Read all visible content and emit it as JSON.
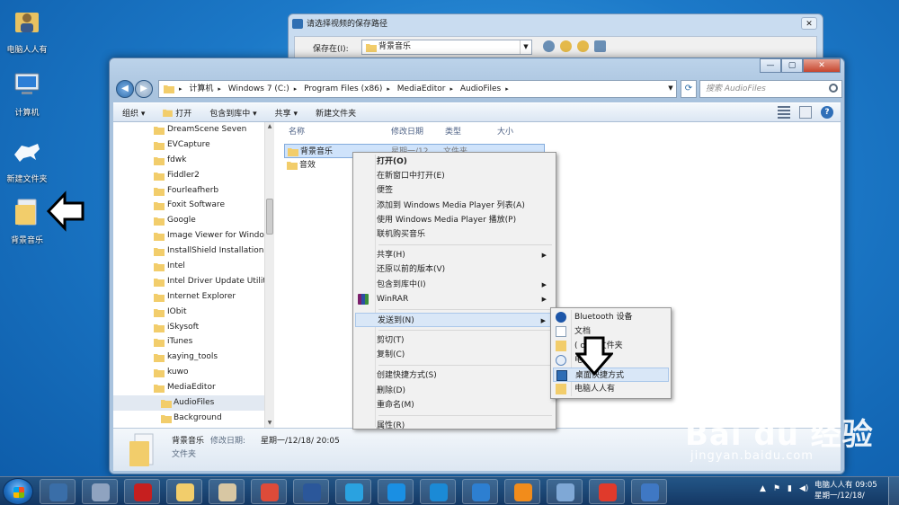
{
  "desktop": {
    "icons": [
      {
        "label": "电脑人人有",
        "icon": "user-folder-icon"
      },
      {
        "label": "计算机",
        "icon": "computer-icon"
      },
      {
        "label": "新建文件夹",
        "icon": "tiger-folder-icon"
      },
      {
        "label": "背景音乐",
        "icon": "folder-icon"
      }
    ]
  },
  "save_dialog": {
    "title": "请选择视频的保存路径",
    "close": "✕",
    "save_in_label": "保存在(I):",
    "save_in_value": "背景音乐"
  },
  "explorer": {
    "controls": {
      "minimize": "—",
      "maximize": "▢",
      "close": "✕"
    },
    "breadcrumb": [
      "计算机",
      "Windows 7 (C:)",
      "Program Files (x86)",
      "MediaEditor",
      "AudioFiles"
    ],
    "search_placeholder": "搜索 AudioFiles",
    "toolbar": {
      "organize": "组织 ▾",
      "open": "打开",
      "include_in_library": "包含到库中 ▾",
      "share": "共享 ▾",
      "new_folder": "新建文件夹"
    },
    "nav_items": [
      "DreamScene Seven",
      "EVCapture",
      "fdwk",
      "Fiddler2",
      "Fourleafherb",
      "Foxit Software",
      "Google",
      "Image Viewer for Windows",
      "InstallShield Installation Information",
      "Intel",
      "Intel Driver Update Utility",
      "Internet Explorer",
      "IObit",
      "iSkysoft",
      "iTunes",
      "kaying_tools",
      "kuwo",
      "MediaEditor"
    ],
    "nav_sub_items": [
      {
        "label": "AudioFiles",
        "selected": true
      },
      {
        "label": "Background",
        "selected": false
      }
    ],
    "columns": {
      "name": "名称",
      "modified": "修改日期",
      "type": "类型",
      "size": "大小"
    },
    "files": [
      {
        "name": "背景音乐",
        "modified": "星期一/12...",
        "type": "文件夹",
        "selected": true
      },
      {
        "name": "音效",
        "modified": "",
        "type": "",
        "selected": false
      }
    ],
    "details": {
      "name": "背景音乐",
      "modified_label": "修改日期:",
      "modified_value": "星期一/12/18/ 20:05",
      "kind": "文件夹"
    }
  },
  "context_menu": {
    "groups": [
      [
        {
          "label": "打开(O)",
          "bold": true
        },
        {
          "label": "在新窗口中打开(E)"
        },
        {
          "label": "便签"
        },
        {
          "label": "添加到 Windows Media Player 列表(A)"
        },
        {
          "label": "使用 Windows Media Player 播放(P)"
        },
        {
          "label": "联机购买音乐"
        }
      ],
      [
        {
          "label": "共享(H)",
          "submenu": true
        },
        {
          "label": "还原以前的版本(V)"
        },
        {
          "label": "包含到库中(I)",
          "submenu": true
        },
        {
          "label": "WinRAR",
          "submenu": true,
          "icon": "winrar-icon"
        }
      ],
      [
        {
          "label": "发送到(N)",
          "submenu": true,
          "highlighted": true
        }
      ],
      [
        {
          "label": "剪切(T)"
        },
        {
          "label": "复制(C)"
        }
      ],
      [
        {
          "label": "创建快捷方式(S)"
        },
        {
          "label": "删除(D)"
        },
        {
          "label": "重命名(M)"
        }
      ],
      [
        {
          "label": "属性(R)"
        }
      ]
    ]
  },
  "send_to_menu": {
    "items": [
      {
        "label": "Bluetooth 设备",
        "icon": "bluetooth-icon"
      },
      {
        "label": "文档",
        "icon": "document-icon"
      },
      {
        "label": "(     oed)文件夹",
        "icon": "zip-folder-icon"
      },
      {
        "label": "电      件人",
        "icon": "mail-icon"
      },
      {
        "label": "桌面快捷方式",
        "icon": "desktop-icon",
        "highlighted": true
      },
      {
        "label": "电脑人人有",
        "icon": "folder-icon"
      }
    ]
  },
  "taskbar": {
    "apps": [
      "remote-desktop-icon",
      "network-tool-icon",
      "game-icon",
      "folder-icon",
      "paint-icon",
      "chrome-icon",
      "word-icon",
      "edge-icon",
      "sogou-icon",
      "ie-icon",
      "media-icon",
      "video-player-icon",
      "files-icon",
      "sogou-input-icon",
      "screen-icon"
    ],
    "clock_line1": "电脑人人有 09:05",
    "clock_line2": "星期一/12/18/"
  },
  "watermark": {
    "logo": "Bai du 经验",
    "url": "jingyan.baidu.com"
  },
  "colors": {
    "accent": "#2f6fb3",
    "selection": "#cfe3fb",
    "menu_highlight": "#d9e7f7"
  }
}
